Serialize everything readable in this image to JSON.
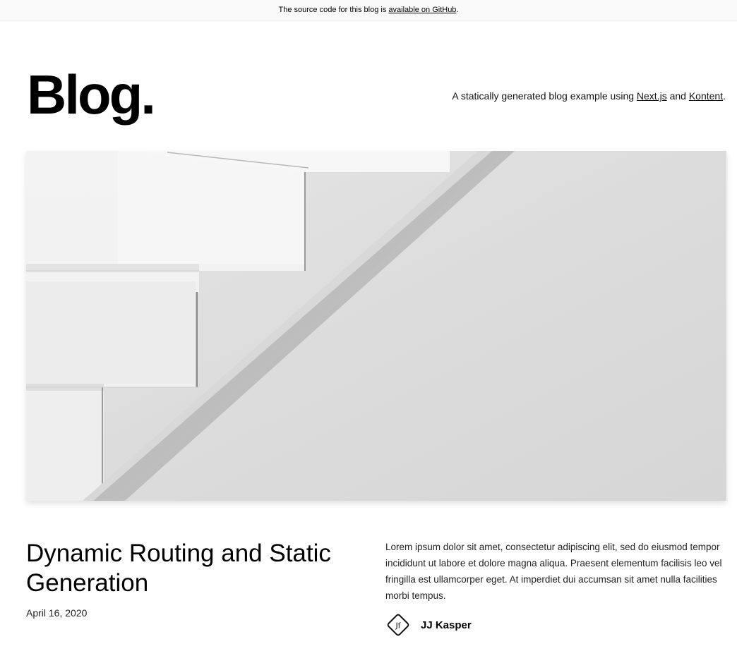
{
  "banner": {
    "text": "The source code for this blog is ",
    "link": "available on GitHub",
    "suffix": "."
  },
  "header": {
    "title": "Blog.",
    "tagline_prefix": "A statically generated blog example using ",
    "link_nextjs": "Next.js",
    "and_text": " and ",
    "link_kontent": "Kontent",
    "tagline_suffix": "."
  },
  "hero_post": {
    "title": "Dynamic Routing and Static Generation",
    "date": "April 16, 2020",
    "excerpt": "Lorem ipsum dolor sit amet, consectetur adipiscing elit, sed do eiusmod tempor incididunt ut labore et dolore magna aliqua. Praesent elementum facilisis leo vel fringilla est ullamcorper eget. At imperdiet dui accumsan sit amet nulla facilities morbi tempus.",
    "author": {
      "name": "JJ Kasper",
      "avatar_icon": "jj-logo-avatar-icon"
    }
  }
}
